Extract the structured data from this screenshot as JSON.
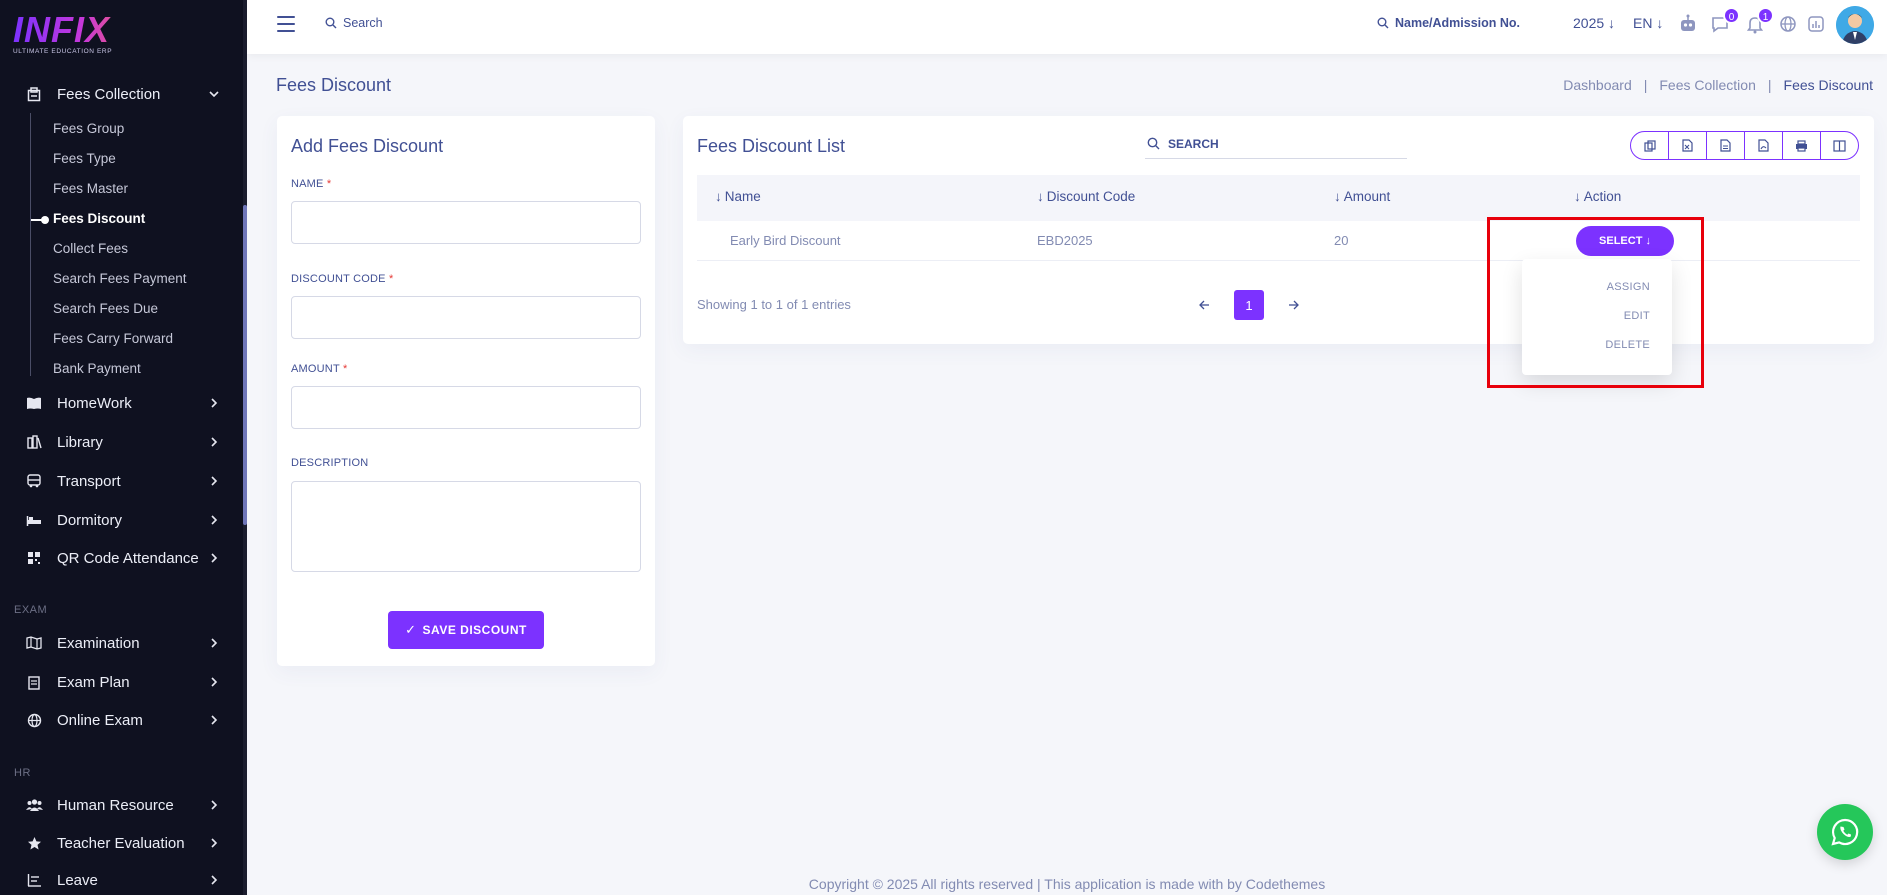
{
  "app": {
    "logo_text": "INFIX",
    "logo_subtitle": "ULTIMATE EDUCATION ERP"
  },
  "sidebar": {
    "fees_collection": "Fees Collection",
    "sub_items": [
      "Fees Group",
      "Fees Type",
      "Fees Master",
      "Fees Discount",
      "Collect Fees",
      "Search Fees Payment",
      "Search Fees Due",
      "Fees Carry Forward",
      "Bank Payment"
    ],
    "active_sub_item": "Fees Discount",
    "items_a": [
      "HomeWork",
      "Library",
      "Transport",
      "Dormitory",
      "QR Code Attendance"
    ],
    "section_exam": "EXAM",
    "items_exam": [
      "Examination",
      "Exam Plan",
      "Online Exam"
    ],
    "section_hr": "HR",
    "items_hr": [
      "Human Resource",
      "Teacher Evaluation",
      "Leave"
    ]
  },
  "topbar": {
    "search_placeholder": "Search",
    "name_search_placeholder": "Name/Admission No.",
    "year": "2025",
    "language": "EN",
    "chat_badge": "0",
    "notification_badge": "1"
  },
  "page": {
    "title": "Fees Discount",
    "breadcrumb": [
      "Dashboard",
      "Fees Collection",
      "Fees Discount"
    ]
  },
  "add_form": {
    "title": "Add Fees Discount",
    "name_label": "NAME",
    "code_label": "DISCOUNT CODE",
    "amount_label": "AMOUNT",
    "description_label": "DESCRIPTION",
    "required_mark": "*",
    "name_value": "",
    "code_value": "",
    "amount_value": "",
    "description_value": "",
    "save_label": "SAVE DISCOUNT"
  },
  "list": {
    "title": "Fees Discount List",
    "search_placeholder": "SEARCH",
    "columns": [
      "Name",
      "Discount Code",
      "Amount",
      "Action"
    ],
    "rows": [
      {
        "name": "Early Bird Discount",
        "code": "EBD2025",
        "amount": "20",
        "action": "SELECT"
      }
    ],
    "showing": "Showing 1 to 1 of 1 entries",
    "current_page": "1",
    "dropdown": [
      "ASSIGN",
      "EDIT",
      "DELETE"
    ]
  },
  "footer": {
    "text": "Copyright © 2025 All rights reserved | This application is made with by Codethemes"
  },
  "colors": {
    "accent": "#7c32ff",
    "sidebar_bg": "#0f1120",
    "text_primary": "#415094",
    "highlight": "#e8000b",
    "whatsapp": "#25c75a"
  }
}
